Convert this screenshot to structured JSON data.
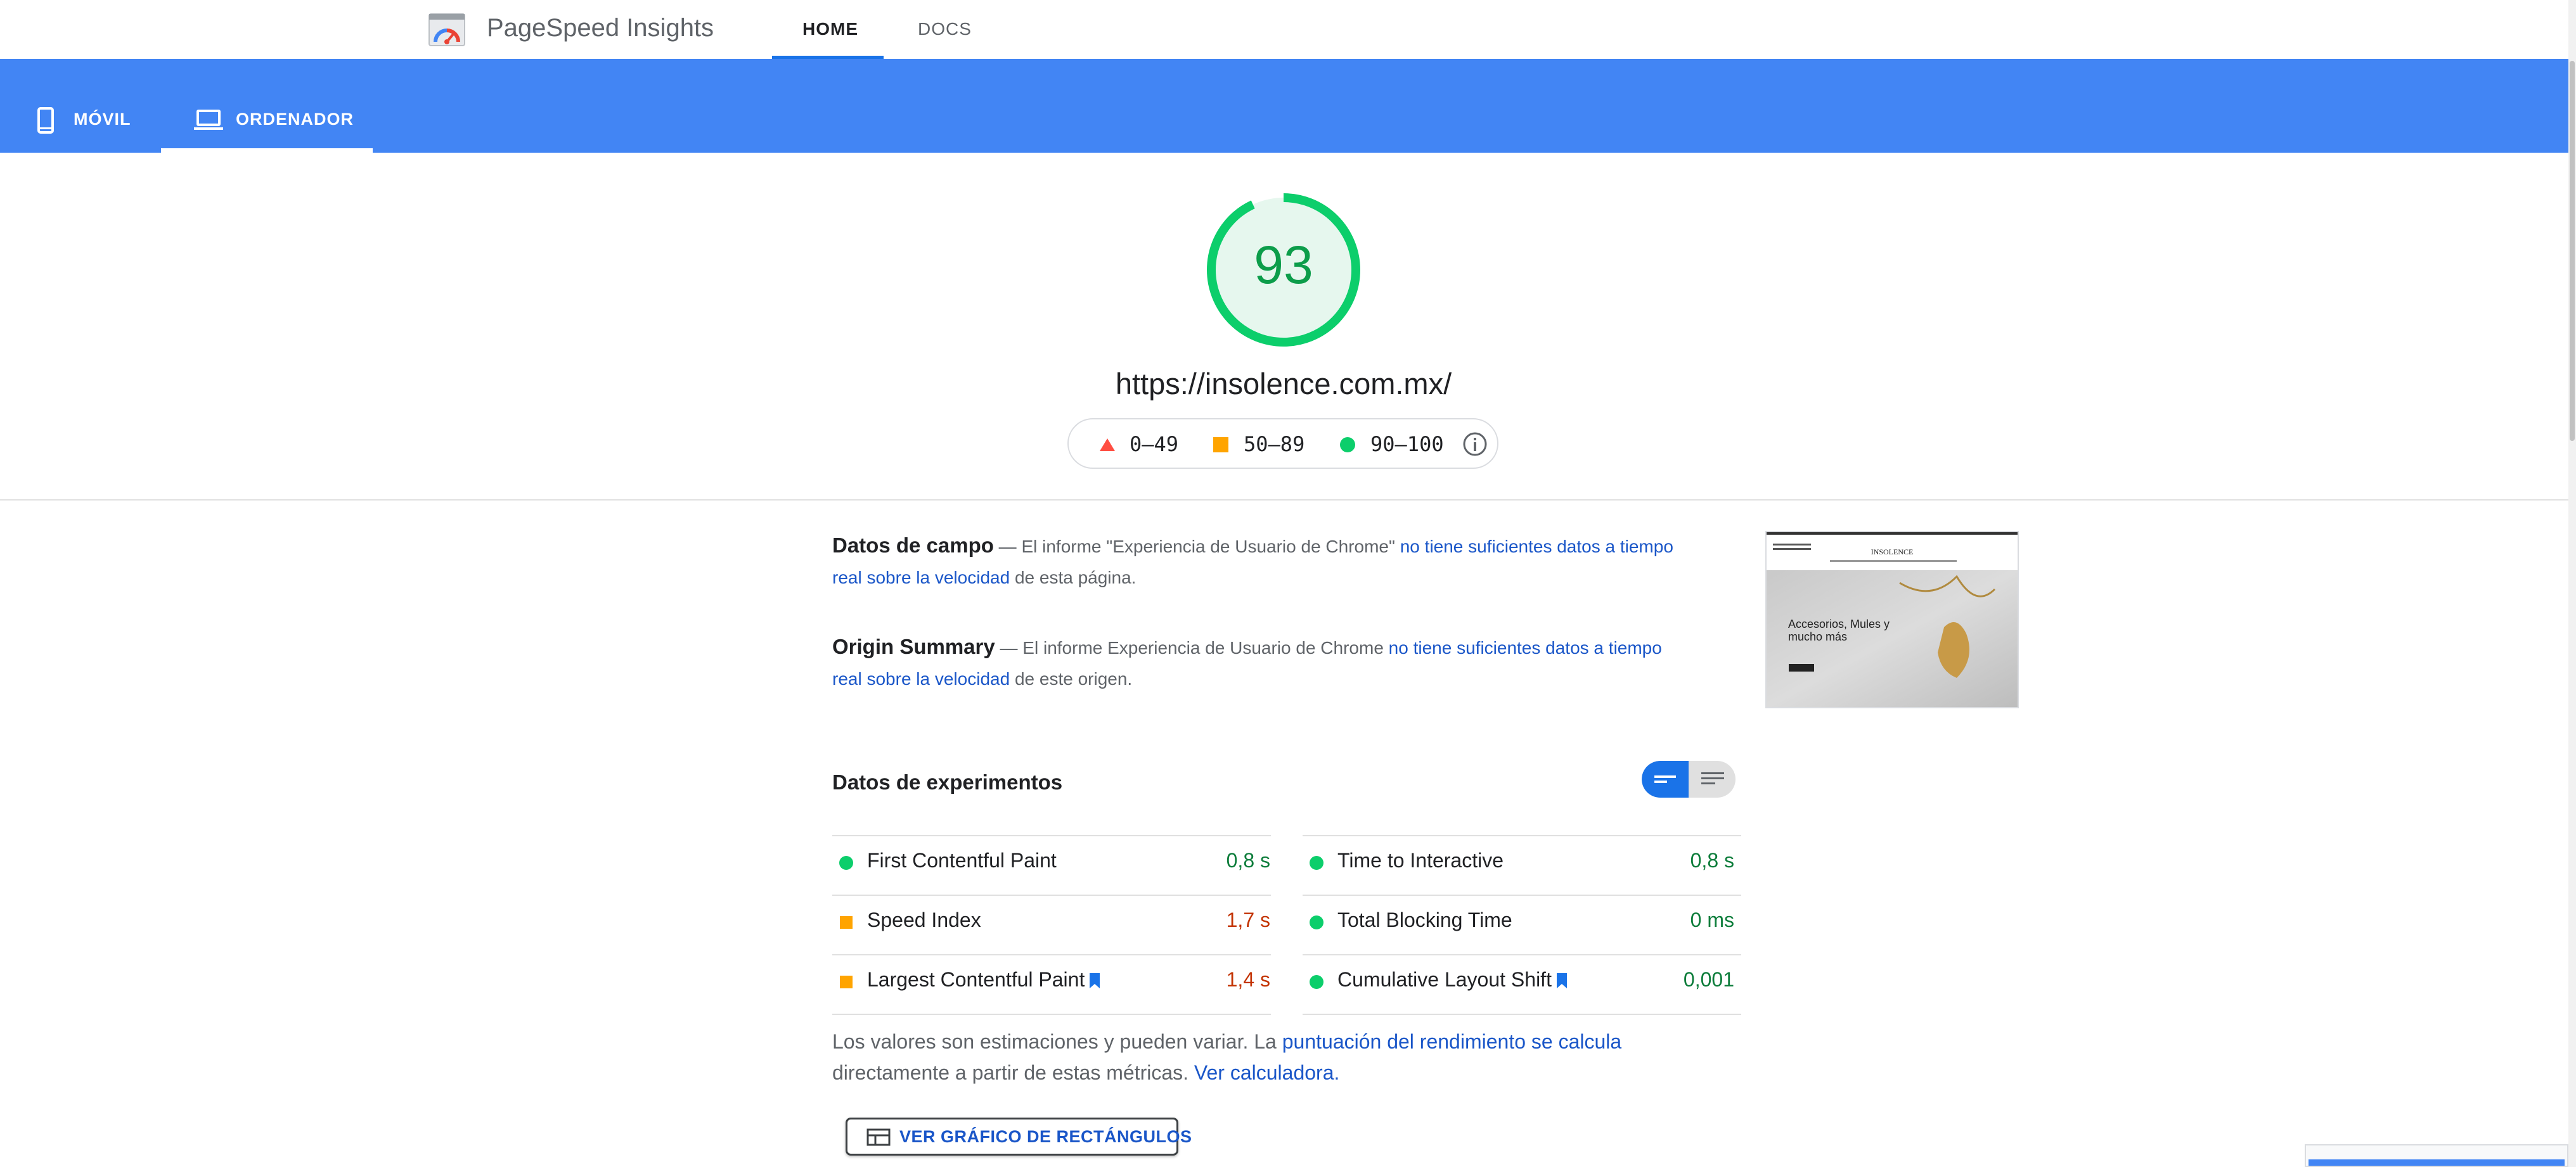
{
  "header": {
    "app_title": "PageSpeed Insights",
    "logo_icon": "pagespeed-logo-icon",
    "tabs": [
      {
        "label": "HOME",
        "active": true
      },
      {
        "label": "DOCS",
        "active": false
      }
    ]
  },
  "devices": [
    {
      "label": "MÓVIL",
      "icon": "smartphone-icon",
      "active": false
    },
    {
      "label": "ORDENADOR",
      "icon": "laptop-icon",
      "active": true
    }
  ],
  "score": {
    "value": "93",
    "fraction": 0.93,
    "color": "#0cce6b"
  },
  "url": "https://insolence.com.mx/",
  "legend": {
    "poor": "0–49",
    "average": "50–89",
    "good": "90–100",
    "poor_color": "#ff4e42",
    "average_color": "#ffa400",
    "good_color": "#0cce6b",
    "info_icon": "info-icon"
  },
  "field_data": {
    "title": "Datos de campo",
    "prefix": " — El informe \"Experiencia de Usuario de Chrome\" ",
    "link": "no tiene suficientes datos a tiempo real sobre la velocidad",
    "suffix": " de esta página."
  },
  "origin_summary": {
    "title": "Origin Summary",
    "prefix": " — El informe Experiencia de Usuario de Chrome ",
    "link": "no tiene suficientes datos a tiempo real sobre la velocidad",
    "suffix": " de este origen."
  },
  "thumbnail": {
    "site_name": "INSOLENCE",
    "hero_text": "Accesorios, Mules y mucho más"
  },
  "lab_data": {
    "title": "Datos de experimentos",
    "metrics_left": [
      {
        "name": "First Contentful Paint",
        "value": "0,8 s",
        "status": "good",
        "flag": false
      },
      {
        "name": "Speed Index",
        "value": "1,7 s",
        "status": "average",
        "flag": false
      },
      {
        "name": "Largest Contentful Paint",
        "value": "1,4 s",
        "status": "average",
        "flag": true
      }
    ],
    "metrics_right": [
      {
        "name": "Time to Interactive",
        "value": "0,8 s",
        "status": "good",
        "flag": false
      },
      {
        "name": "Total Blocking Time",
        "value": "0 ms",
        "status": "good",
        "flag": false
      },
      {
        "name": "Cumulative Layout Shift",
        "value": "0,001",
        "status": "good",
        "flag": true
      }
    ],
    "good_text_color": "#0d7d3b",
    "average_text_color": "#c33300"
  },
  "note": {
    "text1": "Los valores son estimaciones y pueden variar. La ",
    "link1": "puntuación del rendimiento se calcula",
    "text2": " directamente a partir de estas métricas. ",
    "link2": "Ver calculadora."
  },
  "treemap_button": {
    "label": "VER GRÁFICO DE RECTÁNGULOS",
    "icon": "treemap-icon"
  }
}
